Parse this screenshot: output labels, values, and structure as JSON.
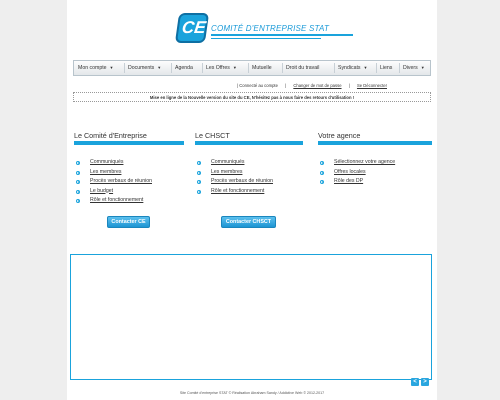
{
  "logo": {
    "mark": "CE",
    "text": "COMITÉ D'ENTREPRISE STAT"
  },
  "nav": {
    "items": [
      {
        "label": "Mon compte",
        "caret": true
      },
      {
        "label": "Documents",
        "caret": true
      },
      {
        "label": "Agenda",
        "caret": false
      },
      {
        "label": "Les Offres",
        "caret": true
      },
      {
        "label": "Mutuelle",
        "caret": false
      },
      {
        "label": "Droit du travail",
        "caret": false
      },
      {
        "label": "Syndicats",
        "caret": true
      },
      {
        "label": "Liens",
        "caret": false
      },
      {
        "label": "Divers",
        "caret": true
      }
    ],
    "caret_glyph": "▼"
  },
  "account": {
    "status": "| Connecté au compte",
    "sep1": "|",
    "change_password": "Changer de mot de passe",
    "sep2": "|",
    "logout": "Se Déconnecter"
  },
  "notice": "Mise en ligne de la Nouvelle version du site du CE, N'hésitez pas à nous faire des retours d'utilisation !",
  "columns": {
    "ce": {
      "title": "Le Comité d'Entreprise",
      "items": [
        "Communiqués",
        "Les membres",
        "Procès verbaux de réunion",
        "Le budget",
        "Rôle et fonctionnement"
      ],
      "button": "Contacter CE"
    },
    "chsct": {
      "title": "Le CHSCT",
      "items": [
        "Communiqués",
        "Les membres",
        "Procès verbaux de réunion",
        "Rôle et fonctionnement"
      ],
      "button": "Contacter CHSCT"
    },
    "agence": {
      "title": "Votre agence",
      "items": [
        "Sélectionnez votre agence",
        "Offres locales",
        "Rôle des DP"
      ]
    }
  },
  "arrows": {
    "prev": "<",
    "next": ">"
  },
  "footer": "Site Comité d'entreprise STAT © Réalisation Abraham Sandy / Addictive Web © 2012-2017",
  "colors": {
    "accent": "#1aa3dc",
    "background": "#eeeeee"
  }
}
